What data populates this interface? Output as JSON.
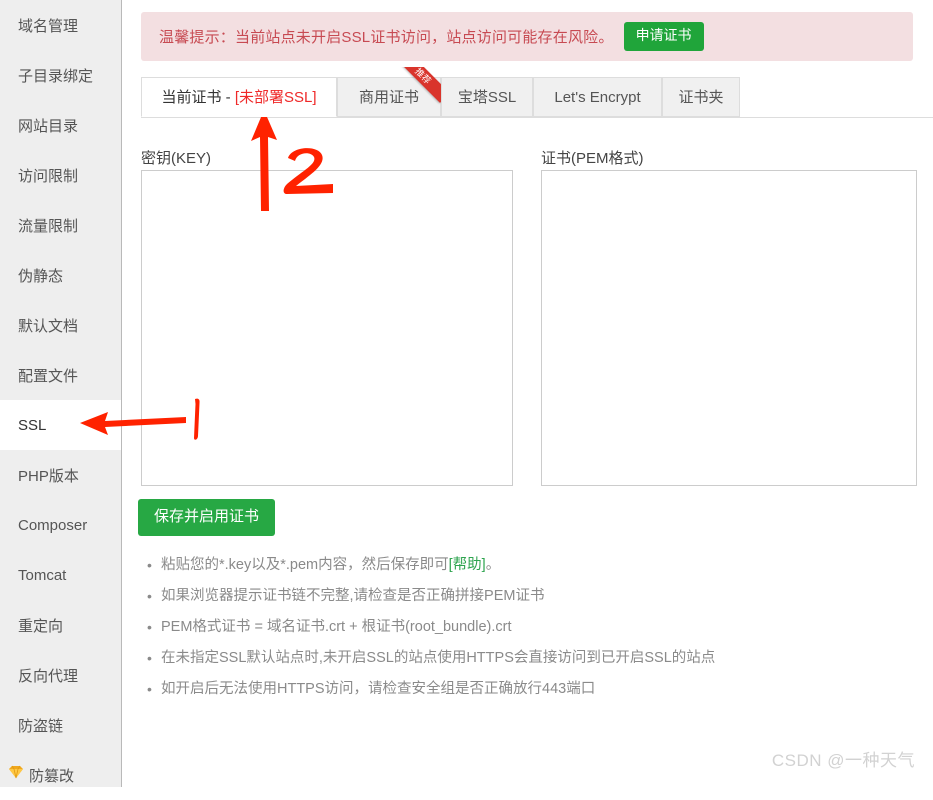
{
  "sidebar": {
    "items": [
      {
        "label": "域名管理",
        "active": false,
        "icon": null
      },
      {
        "label": "子目录绑定",
        "active": false,
        "icon": null
      },
      {
        "label": "网站目录",
        "active": false,
        "icon": null
      },
      {
        "label": "访问限制",
        "active": false,
        "icon": null
      },
      {
        "label": "流量限制",
        "active": false,
        "icon": null
      },
      {
        "label": "伪静态",
        "active": false,
        "icon": null
      },
      {
        "label": "默认文档",
        "active": false,
        "icon": null
      },
      {
        "label": "配置文件",
        "active": false,
        "icon": null
      },
      {
        "label": "SSL",
        "active": true,
        "icon": null
      },
      {
        "label": "PHP版本",
        "active": false,
        "icon": null
      },
      {
        "label": "Composer",
        "active": false,
        "icon": null
      },
      {
        "label": "Tomcat",
        "active": false,
        "icon": null
      },
      {
        "label": "重定向",
        "active": false,
        "icon": null
      },
      {
        "label": "反向代理",
        "active": false,
        "icon": null
      },
      {
        "label": "防盗链",
        "active": false,
        "icon": null
      },
      {
        "label": "防篡改",
        "active": false,
        "icon": "gem-icon"
      }
    ]
  },
  "banner": {
    "text": "温馨提示：当前站点未开启SSL证书访问，站点访问可能存在风险。",
    "button_label": "申请证书",
    "background_color": "#f3dfe1",
    "text_color": "#c74a52",
    "button_color": "#20a53a"
  },
  "tabs": [
    {
      "label_prefix": "当前证书 - ",
      "label_status": "[未部署SSL]",
      "active": true,
      "badge": null
    },
    {
      "label_prefix": "商用证书",
      "label_status": "",
      "active": false,
      "badge": "推荐"
    },
    {
      "label_prefix": "宝塔SSL",
      "label_status": "",
      "active": false,
      "badge": null
    },
    {
      "label_prefix": "Let's Encrypt",
      "label_status": "",
      "active": false,
      "badge": null
    },
    {
      "label_prefix": "证书夹",
      "label_status": "",
      "active": false,
      "badge": null
    }
  ],
  "form": {
    "key_label": "密钥(KEY)",
    "key_value": "",
    "key_placeholder": "",
    "pem_label": "证书(PEM格式)",
    "pem_value": "",
    "pem_placeholder": "",
    "save_label": "保存并启用证书"
  },
  "tips": [
    {
      "pre": "粘贴您的*.key以及*.pem内容，然后保存即可",
      "link": "[帮助]",
      "post": "。"
    },
    {
      "pre": "如果浏览器提示证书链不完整,请检查是否正确拼接PEM证书",
      "link": "",
      "post": ""
    },
    {
      "pre": "PEM格式证书 = 域名证书.crt + 根证书(root_bundle).crt",
      "link": "",
      "post": ""
    },
    {
      "pre": "在未指定SSL默认站点时,未开启SSL的站点使用HTTPS会直接访问到已开启SSL的站点",
      "link": "",
      "post": ""
    },
    {
      "pre": "如开启后无法使用HTTPS访问，请检查安全组是否正确放行443端口",
      "link": "",
      "post": ""
    }
  ],
  "annotations": {
    "marker_1": "1",
    "marker_2": "2",
    "color": "#ff2200"
  },
  "watermark": "CSDN @一种天气"
}
